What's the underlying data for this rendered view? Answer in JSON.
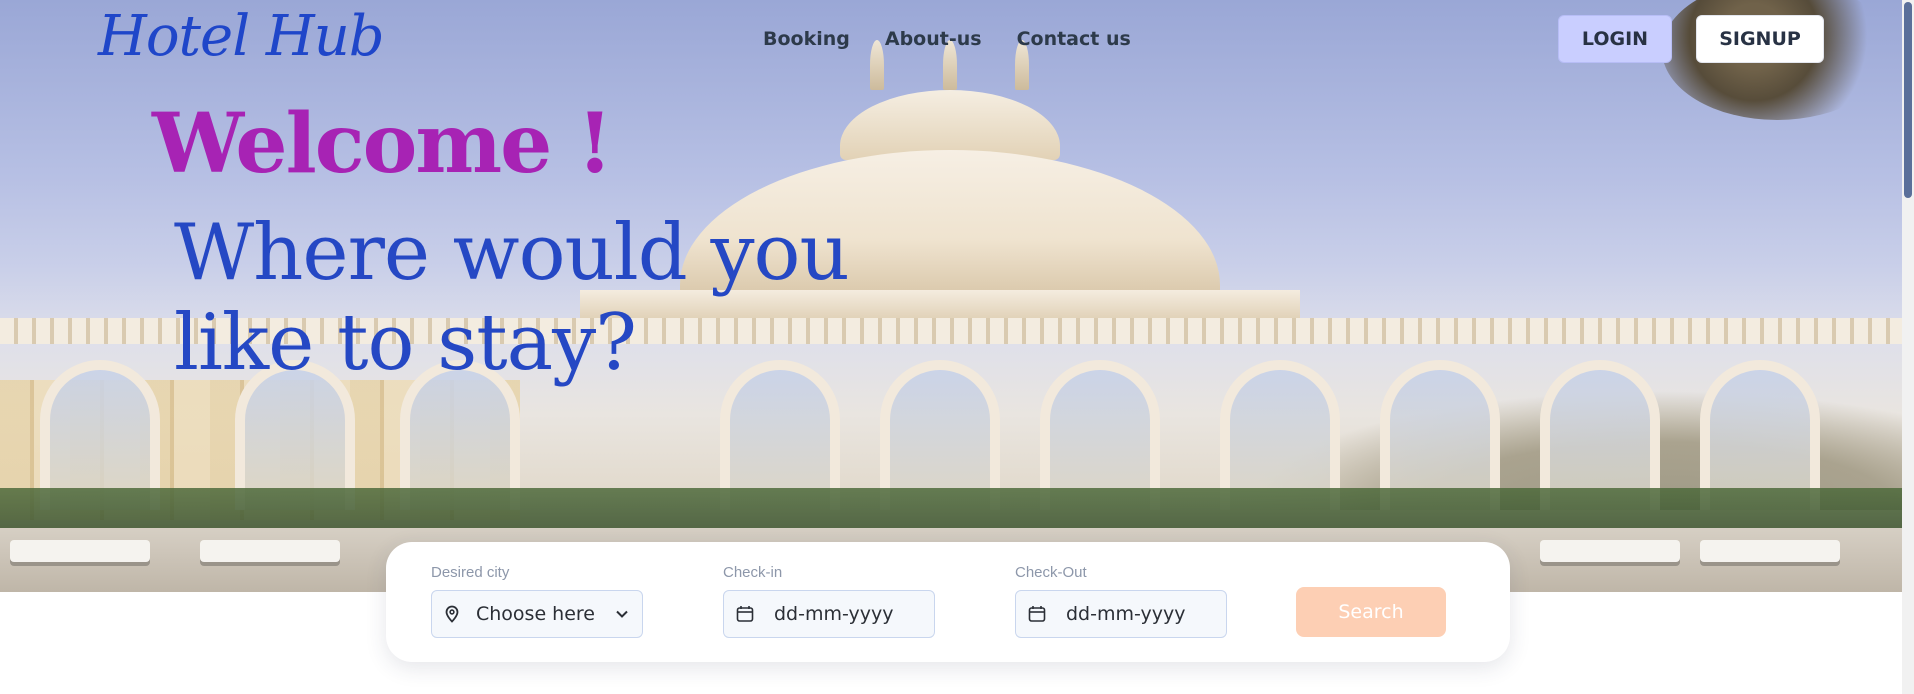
{
  "brand": {
    "logo_text": "Hotel Hub"
  },
  "nav": {
    "items": [
      {
        "label": "Booking"
      },
      {
        "label": "About-us"
      },
      {
        "label": "Contact us"
      }
    ]
  },
  "auth": {
    "login_label": "LOGIN",
    "signup_label": "SIGNUP"
  },
  "hero": {
    "welcome": "Welcome !",
    "tagline_line1": "Where would you",
    "tagline_line2": "like to stay?"
  },
  "search": {
    "city": {
      "label": "Desired city",
      "value": "Choose here"
    },
    "checkin": {
      "label": "Check-in",
      "placeholder": "dd-mm-yyyy"
    },
    "checkout": {
      "label": "Check-Out",
      "placeholder": "dd-mm-yyyy"
    },
    "button_label": "Search"
  },
  "icons": {
    "city": "location-pin-icon",
    "checkin": "calendar-icon",
    "checkout": "calendar-icon",
    "city_dropdown": "chevron-down-icon"
  },
  "colors": {
    "logo": "#1f46c9",
    "welcome": "#a723b4",
    "tagline": "#2548c4",
    "login_bg": "#c9ceff",
    "search_button": "#fdcfb4"
  }
}
